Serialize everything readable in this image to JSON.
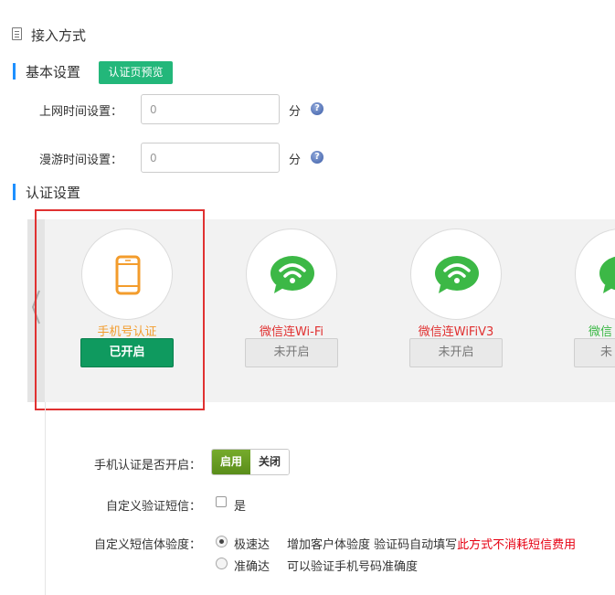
{
  "header": {
    "title": "接入方式",
    "icon": "document-icon"
  },
  "basic": {
    "title": "基本设置",
    "preview_button": "认证页预览",
    "online_time": {
      "label": "上网时间设置：",
      "value": "",
      "placeholder": "0",
      "unit": "分"
    },
    "roaming_time": {
      "label": "漫游时间设置：",
      "value": "",
      "placeholder": "0",
      "unit": "分"
    }
  },
  "auth": {
    "title": "认证设置",
    "cards": [
      {
        "name": "手机号认证",
        "status": "已开启",
        "icon": "mobile-phone-icon",
        "enabled": true
      },
      {
        "name": "微信连Wi-Fi",
        "status": "未开启",
        "icon": "wechat-wifi-icon",
        "enabled": false
      },
      {
        "name": "微信连WiFiV3",
        "status": "未开启",
        "icon": "wechat-wifi-icon",
        "enabled": false
      },
      {
        "name": "微信",
        "status": "未",
        "icon": "wechat-icon",
        "enabled": false
      }
    ]
  },
  "phone_settings": {
    "enable_label": "手机认证是否开启：",
    "enable_on": "启用",
    "enable_off": "关闭",
    "custom_sms_label": "自定义验证短信：",
    "custom_sms_option": "是",
    "experience_label": "自定义短信体验度：",
    "options": [
      {
        "label": "极速达",
        "desc": "增加客户体验度 验证码自动填写",
        "warning": "此方式不消耗短信费用",
        "checked": true
      },
      {
        "label": "准确达",
        "desc": "可以验证手机号码准确度",
        "warning": "",
        "checked": false
      }
    ]
  },
  "colors": {
    "accent_blue": "#1e90ff",
    "preview_green": "#23b77a",
    "enabled_green": "#0f9a5f",
    "phone_orange": "#f39c2c",
    "wechat_green": "#3cb846",
    "wechat_text_red": "#e03131",
    "highlight_red": "#e03131"
  }
}
